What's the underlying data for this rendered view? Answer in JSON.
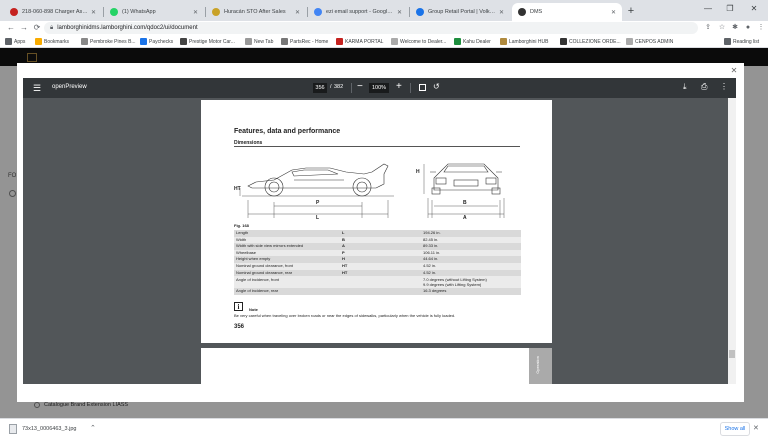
{
  "tabs": [
    {
      "label": "218-060-898 Charger Assembly",
      "fav": "#c5221f"
    },
    {
      "label": "(1) WhatsApp",
      "fav": "#25d366"
    },
    {
      "label": "Huracán STO After Sales",
      "fav": "#c9a227"
    },
    {
      "label": "ezi email support - Google Sea",
      "fav": "#4285f4"
    },
    {
      "label": "Group Retail Portal | Volkswagen",
      "fav": "#1a73e8"
    },
    {
      "label": "DMS",
      "fav": "#333333"
    }
  ],
  "url": "lamborghinidms.lamborghini.com/qdoc2/ui/document",
  "bookmarks": [
    {
      "label": "Apps",
      "color": "#5f6368"
    },
    {
      "label": "Bookmarks",
      "color": "#f9ab00"
    },
    {
      "label": "Pembroke Pines B...",
      "color": "#888888"
    },
    {
      "label": "Paychecks",
      "color": "#1a73e8"
    },
    {
      "label": "Prestige Motor Car...",
      "color": "#444444"
    },
    {
      "label": "New Tab",
      "color": "#999999"
    },
    {
      "label": "PartsRec - Home",
      "color": "#777777"
    },
    {
      "label": "KARMA PORTAL",
      "color": "#c5221f"
    },
    {
      "label": "Welcome to Dealer...",
      "color": "#aaaaaa"
    },
    {
      "label": "Kahu Dealer",
      "color": "#1e8e3e"
    },
    {
      "label": "Lamborghini HUB",
      "color": "#b08a3e"
    },
    {
      "label": "COLLEZIONE ORDE...",
      "color": "#333333"
    },
    {
      "label": "CENPOS ADMIN",
      "color": "#aaaaaa"
    }
  ],
  "reading_list": "Reading list",
  "page_behind": {
    "snippet": "FO",
    "item": "Catalogue Brand Extension LIASS"
  },
  "viewer": {
    "title": "openPreview",
    "page_current": "356",
    "page_sep": "/",
    "page_total": "382",
    "zoom": "100%"
  },
  "doc": {
    "title": "Features, data and performance",
    "subtitle": "Dimensions",
    "fig_label": "Fig. 168",
    "fig_labels": {
      "ht": "HT",
      "p": "P",
      "l": "L",
      "h": "H",
      "b": "B",
      "a": "A"
    },
    "table": [
      {
        "name": "Length",
        "sym": "L",
        "val": "194.26 in."
      },
      {
        "name": "Width",
        "sym": "B",
        "val": "82.45 in."
      },
      {
        "name": "Width with side view mirrors extended",
        "sym": "A",
        "val": "89.33 in."
      },
      {
        "name": "Wheelbase",
        "sym": "P",
        "val": "106.11 in."
      },
      {
        "name": "Height when empty",
        "sym": "H",
        "val": "44.64 in."
      },
      {
        "name": "Nominal ground clearance, front",
        "sym": "HT",
        "val": "4.52 in."
      },
      {
        "name": "Nominal ground clearance, rear",
        "sym": "HT",
        "val": "4.52 in."
      },
      {
        "name": "Angle of incidence, front",
        "sym": "",
        "val": "7.0 degrees (without Lifting System)",
        "val2": "9.9 degrees (with Lifting System)"
      },
      {
        "name": "Angle of incidence, rear",
        "sym": "",
        "val": "16.3 degrees"
      }
    ],
    "note_icon": "i",
    "note_title": "Note",
    "note_text": "Be very careful when traveling over broken roads or near the edges of sidewalks, particularly when the vehicle is fully loaded.",
    "page_number": "356",
    "next_tab": "Operation"
  },
  "download": {
    "file": "73x13_0006463_3.jpg",
    "show_all": "Show all"
  },
  "icons": {
    "back": "arrow-left-icon",
    "forward": "arrow-right-icon",
    "reload": "reload-icon",
    "lock": "lock-icon",
    "menu": "hamburger-icon",
    "download": "download-icon",
    "print": "print-icon",
    "more": "more-vert-icon"
  }
}
